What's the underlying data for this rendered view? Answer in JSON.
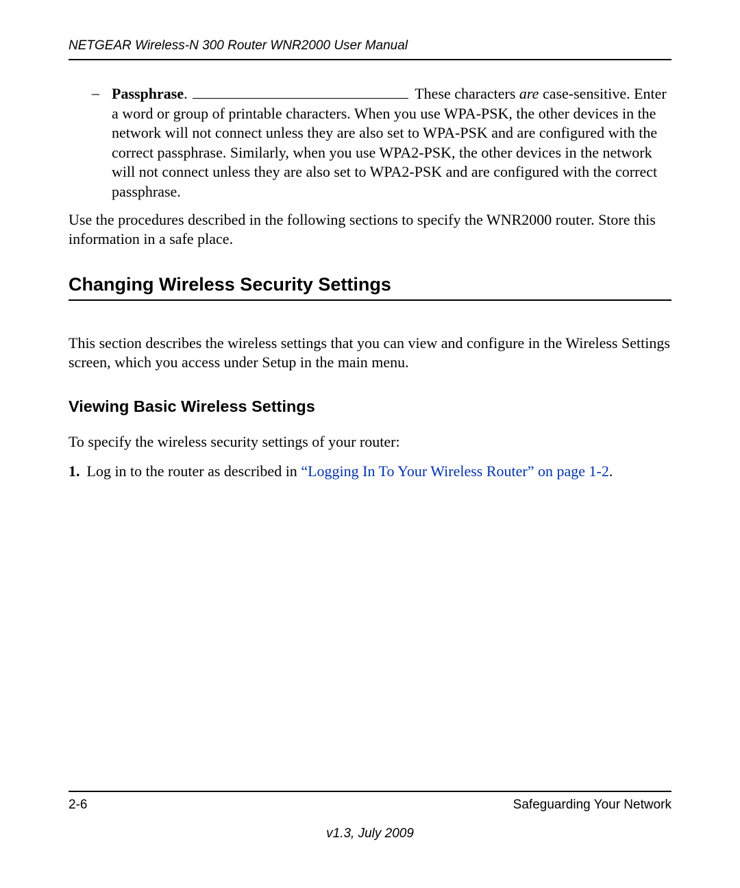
{
  "header": {
    "title": "NETGEAR Wireless-N 300 Router WNR2000 User Manual"
  },
  "bullet": {
    "dash": "–",
    "label": "Passphrase",
    "period": ". ",
    "note_prefix": "These characters ",
    "note_are": "are",
    "note_suffix": " case-sensitive. Enter a word or group of printable characters. When you use WPA-PSK, the other devices in the network will not connect unless they are also set to WPA-PSK and are configured with the correct passphrase. Similarly, when you use WPA2-PSK, the other devices in the network will not connect unless they are also set to WPA2-PSK and are configured with the correct passphrase."
  },
  "para_after_bullet": "Use the procedures described in the following sections to specify the WNR2000 router. Store this information in a safe place.",
  "section_heading": "Changing Wireless Security Settings",
  "section_intro": "This section describes the wireless settings that you can view and configure in the Wireless Settings screen, which you access under Setup in the main menu.",
  "subsection_heading": "Viewing Basic Wireless Settings",
  "sub_intro": "To specify the wireless security settings of your router:",
  "steps": [
    {
      "number": "1.",
      "prefix": "Log in to the router as described in ",
      "link": "“Logging In To Your Wireless Router” on page 1-2",
      "suffix": "."
    }
  ],
  "footer": {
    "page": "2-6",
    "section": "Safeguarding Your Network",
    "version": "v1.3, July 2009"
  }
}
